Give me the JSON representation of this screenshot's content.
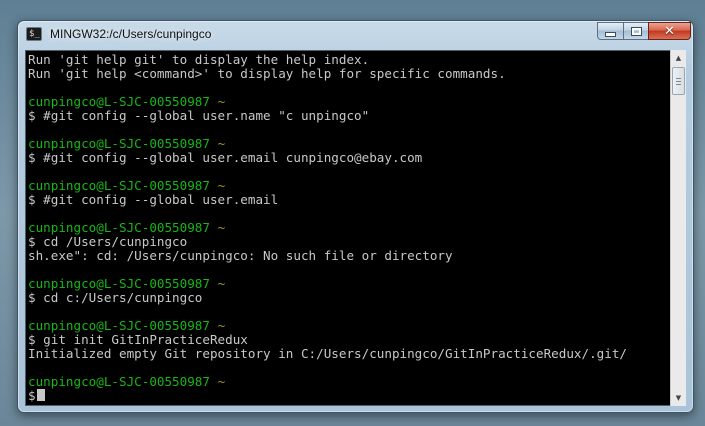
{
  "window": {
    "title": "MINGW32:/c/Users/cunpingco",
    "icon_label": "$_"
  },
  "controls": {
    "minimize": "minimize-icon",
    "maximize": "maximize-icon",
    "close": "✕"
  },
  "terminal": {
    "lines": [
      {
        "t": "Run 'git help git' to display the help index.",
        "c": "white"
      },
      {
        "t": "Run 'git help <command>' to display help for specific commands.",
        "c": "white"
      },
      {
        "t": "",
        "c": "white"
      },
      {
        "t": "cunpingco@L-SJC-00550987",
        "t2": " ~",
        "c": "green"
      },
      {
        "t": "$ #git config --global user.name \"c unpingco\"",
        "c": "white"
      },
      {
        "t": "",
        "c": "white"
      },
      {
        "t": "cunpingco@L-SJC-00550987",
        "t2": " ~",
        "c": "green"
      },
      {
        "t": "$ #git config --global user.email cunpingco@ebay.com",
        "c": "white"
      },
      {
        "t": "",
        "c": "white"
      },
      {
        "t": "cunpingco@L-SJC-00550987",
        "t2": " ~",
        "c": "green"
      },
      {
        "t": "$ #git config --global user.email",
        "c": "white"
      },
      {
        "t": "",
        "c": "white"
      },
      {
        "t": "cunpingco@L-SJC-00550987",
        "t2": " ~",
        "c": "green"
      },
      {
        "t": "$ cd /Users/cunpingco",
        "c": "white"
      },
      {
        "t": "sh.exe\": cd: /Users/cunpingco: No such file or directory",
        "c": "white"
      },
      {
        "t": "",
        "c": "white"
      },
      {
        "t": "cunpingco@L-SJC-00550987",
        "t2": " ~",
        "c": "green"
      },
      {
        "t": "$ cd c:/Users/cunpingco",
        "c": "white"
      },
      {
        "t": "",
        "c": "white"
      },
      {
        "t": "cunpingco@L-SJC-00550987",
        "t2": " ~",
        "c": "green"
      },
      {
        "t": "$ git init GitInPracticeRedux",
        "c": "white"
      },
      {
        "t": "Initialized empty Git repository in C:/Users/cunpingco/GitInPracticeRedux/.git/",
        "c": "white"
      },
      {
        "t": "",
        "c": "white"
      },
      {
        "t": "cunpingco@L-SJC-00550987",
        "t2": " ~",
        "c": "green"
      },
      {
        "t": "$",
        "c": "white",
        "cursor": true
      }
    ]
  },
  "scrollbar": {
    "up": "▲",
    "down": "▼"
  },
  "colors": {
    "background": "#000000",
    "text": "#c8c8c8",
    "prompt_user": "#16b616",
    "prompt_path": "#9a9a20"
  }
}
